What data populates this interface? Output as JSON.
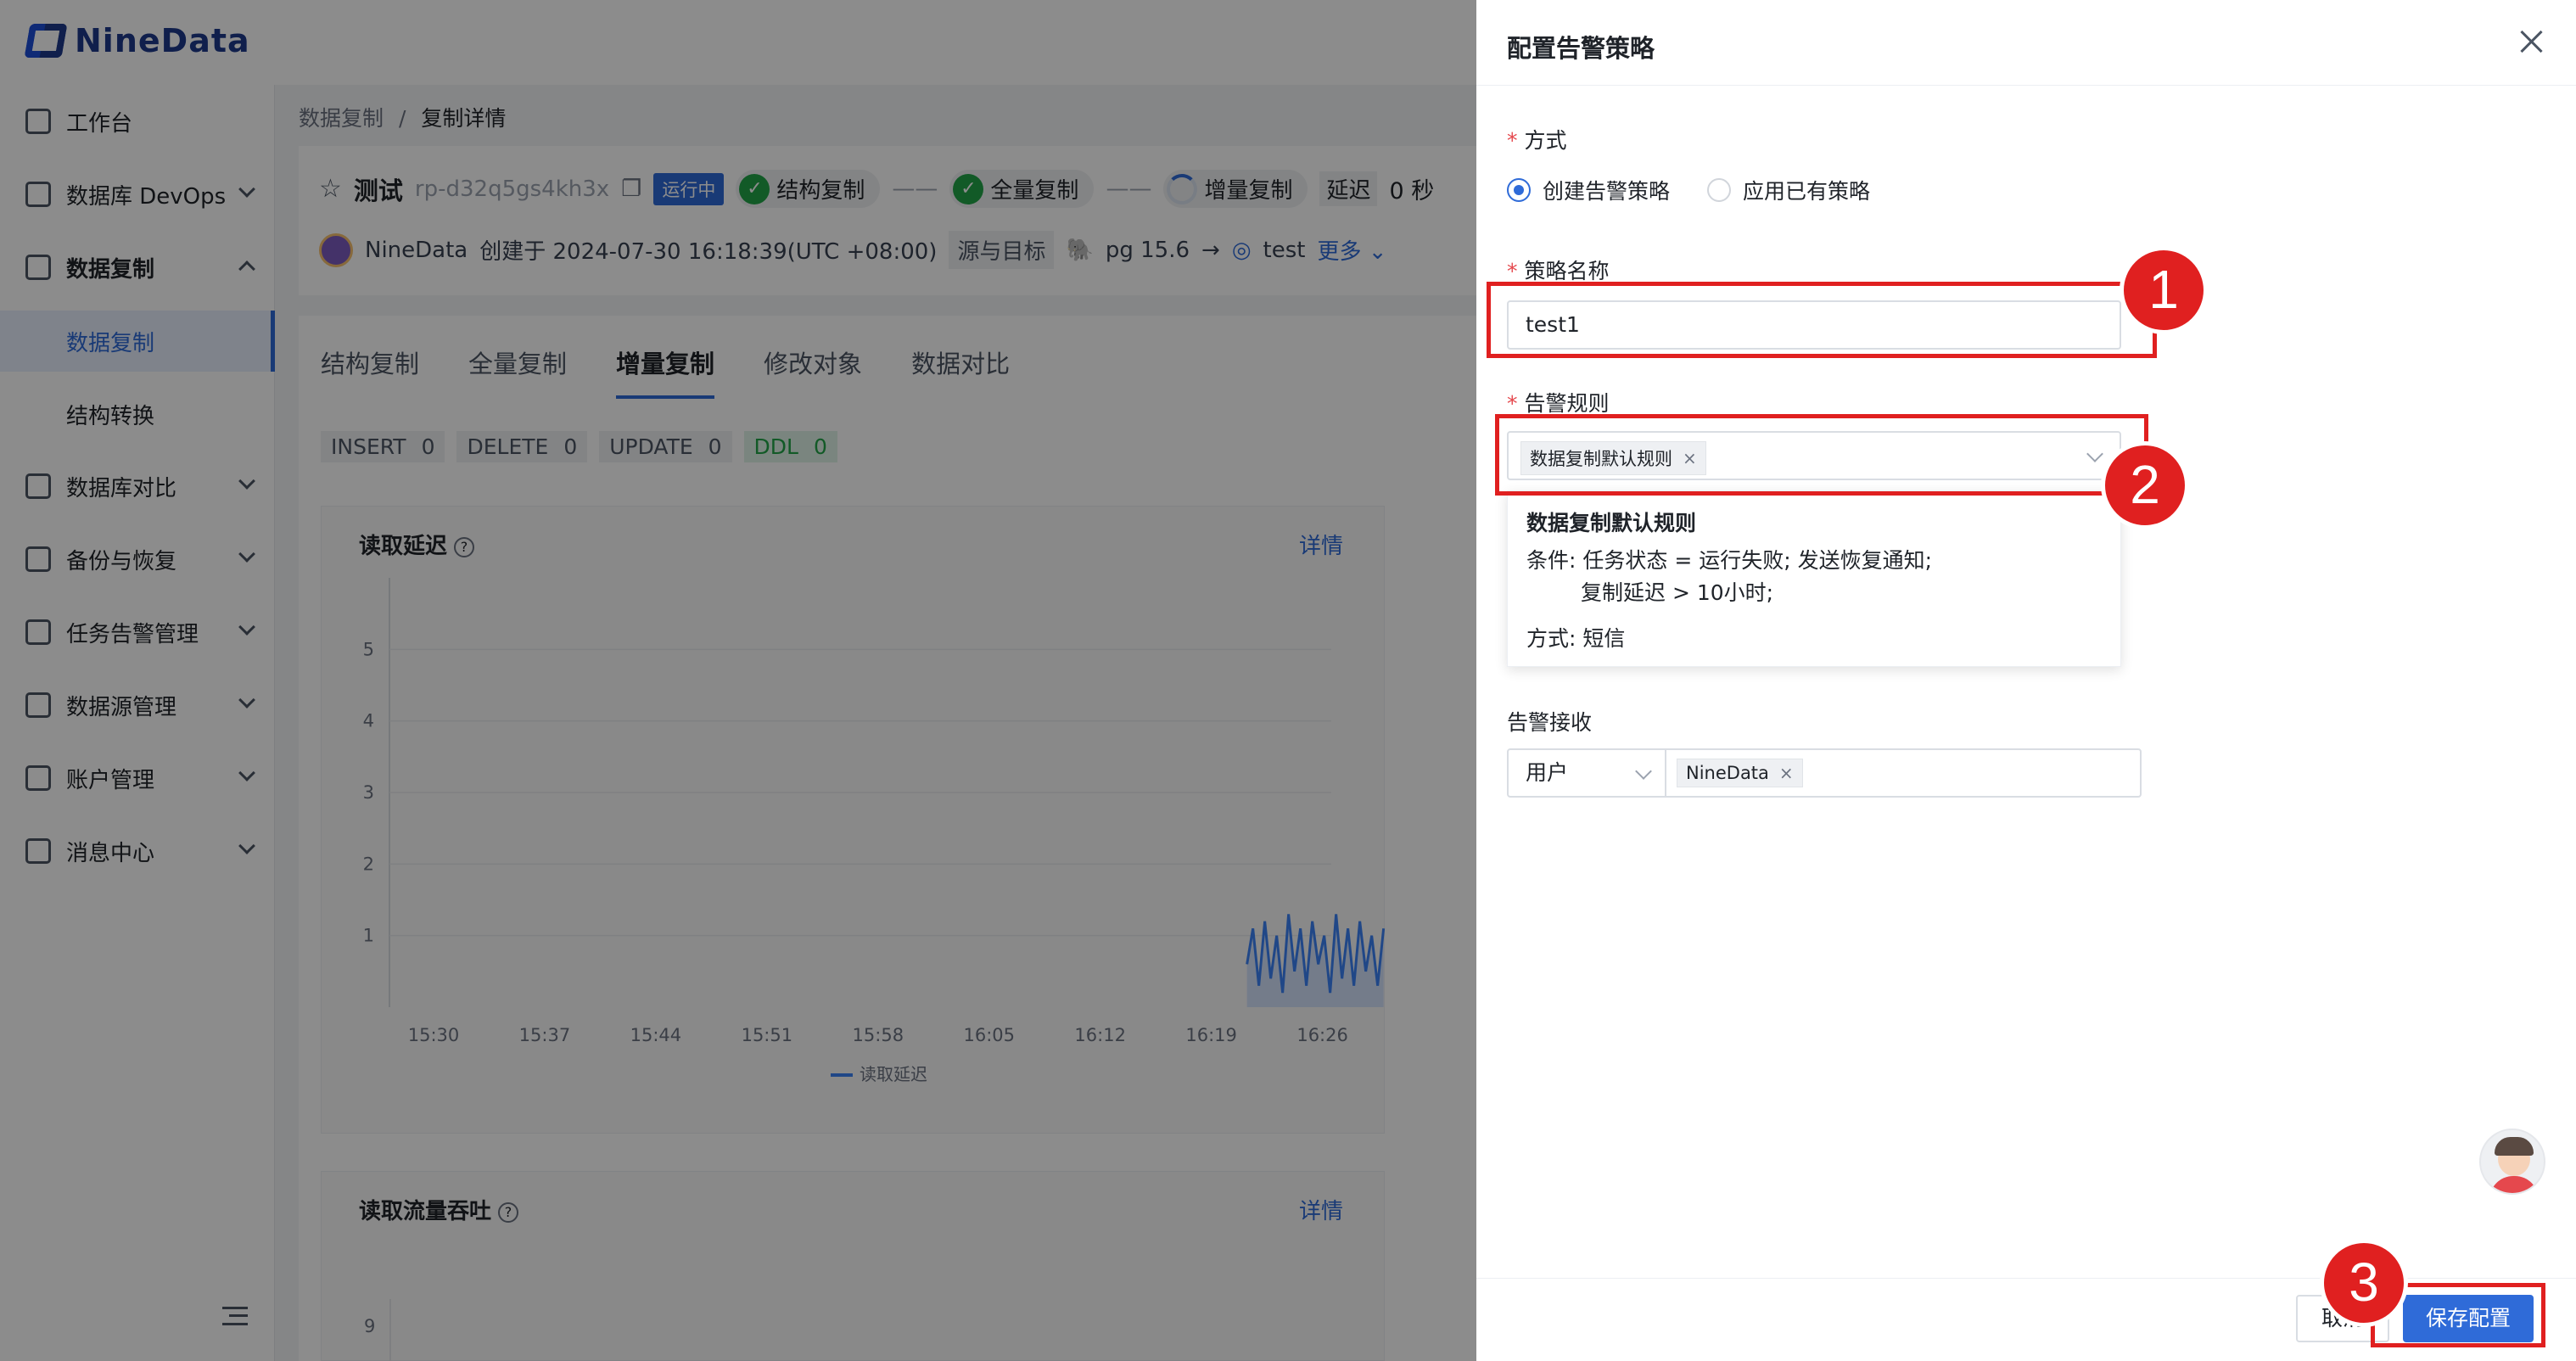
{
  "app": {
    "brand": "NineData",
    "breadcrumb": {
      "parent": "数据复制",
      "separator": "/",
      "current": "复制详情"
    }
  },
  "sidebar": {
    "items": [
      {
        "label": "工作台",
        "icon": "home-icon"
      },
      {
        "label": "数据库 DevOps",
        "icon": "monitor-icon"
      },
      {
        "label": "数据复制",
        "icon": "replicate-icon"
      },
      {
        "label": "数据复制",
        "sub": true,
        "active": true
      },
      {
        "label": "结构转换",
        "sub": true
      },
      {
        "label": "数据库对比",
        "icon": "compare-icon"
      },
      {
        "label": "备份与恢复",
        "icon": "cloud-icon"
      },
      {
        "label": "任务告警管理",
        "icon": "alarm-icon"
      },
      {
        "label": "数据源管理",
        "icon": "datasource-icon"
      },
      {
        "label": "账户管理",
        "icon": "account-icon"
      },
      {
        "label": "消息中心",
        "icon": "mail-icon"
      }
    ]
  },
  "task": {
    "name": "测试",
    "id": "rp-d32q5gs4kh3x",
    "status": "运行中",
    "stages": [
      "结构复制",
      "全量复制",
      "增量复制"
    ],
    "delay_label": "延迟",
    "delay_value": "0 秒",
    "creator": "NineData",
    "created_text": "创建于 2024-07-30 16:18:39(UTC +08:00)",
    "src_label": "源与目标",
    "source": "pg 15.6",
    "arrow": "→",
    "target": "test",
    "more": "更多"
  },
  "tabs": [
    "结构复制",
    "全量复制",
    "增量复制",
    "修改对象",
    "数据对比"
  ],
  "counters": [
    {
      "label": "INSERT",
      "value": "0"
    },
    {
      "label": "DELETE",
      "value": "0"
    },
    {
      "label": "UPDATE",
      "value": "0"
    },
    {
      "label": "DDL",
      "value": "0"
    }
  ],
  "charts": {
    "read_delay": {
      "title": "读取延迟",
      "more": "详情"
    },
    "read_throughput": {
      "title": "读取流量吞吐",
      "more": "详情",
      "first_tick": "9"
    }
  },
  "chart_data": {
    "type": "line",
    "title": "读取延迟",
    "x": [
      "15:30",
      "15:37",
      "15:44",
      "15:51",
      "15:58",
      "16:05",
      "16:12",
      "16:19",
      "16:26"
    ],
    "y_ticks": [
      "1",
      "2",
      "3",
      "4",
      "5"
    ],
    "ylim": [
      0,
      6
    ],
    "series": [
      {
        "name": "读取延迟",
        "color": "#3b82f6",
        "points": [
          [
            0.0,
            0.6
          ],
          [
            0.25,
            1.1
          ],
          [
            0.5,
            0.3
          ],
          [
            0.75,
            1.2
          ],
          [
            1.0,
            0.4
          ],
          [
            1.25,
            1.0
          ],
          [
            1.5,
            0.2
          ],
          [
            1.75,
            1.3
          ],
          [
            2.0,
            0.5
          ],
          [
            2.25,
            1.1
          ],
          [
            2.5,
            0.3
          ],
          [
            2.75,
            1.2
          ],
          [
            3.0,
            0.6
          ],
          [
            3.25,
            1.0
          ],
          [
            3.5,
            0.2
          ],
          [
            3.75,
            1.3
          ],
          [
            4.0,
            0.4
          ],
          [
            4.25,
            1.1
          ],
          [
            4.5,
            0.3
          ],
          [
            4.75,
            1.2
          ],
          [
            5.0,
            0.5
          ],
          [
            5.25,
            1.0
          ],
          [
            5.5,
            0.3
          ],
          [
            5.75,
            1.1
          ]
        ],
        "x_offset_label": "16:19"
      }
    ],
    "legend": "bottom-center",
    "grid": true
  },
  "drawer": {
    "title": "配置告警策略",
    "method_label": "方式",
    "method_options": [
      "创建告警策略",
      "应用已有策略"
    ],
    "method_selected": 0,
    "name_label": "策略名称",
    "name_value": "test1",
    "rule_label": "告警规则",
    "rule_tag": "数据复制默认规则",
    "rule_popup": {
      "title": "数据复制默认规则",
      "condition": "条件: 任务状态 = 运行失败; 发送恢复通知;",
      "condition2": "复制延迟 > 10小时;",
      "method": "方式: 短信"
    },
    "recv_label": "告警接收",
    "recv_type": "用户",
    "recv_tag": "NineData",
    "cancel": "取消",
    "save": "保存配置",
    "tag_close": "×"
  },
  "annotations": [
    "1",
    "2",
    "3"
  ],
  "colors": {
    "accent": "#2f6bd8",
    "success": "#22a447",
    "annotation": "#e02020"
  }
}
